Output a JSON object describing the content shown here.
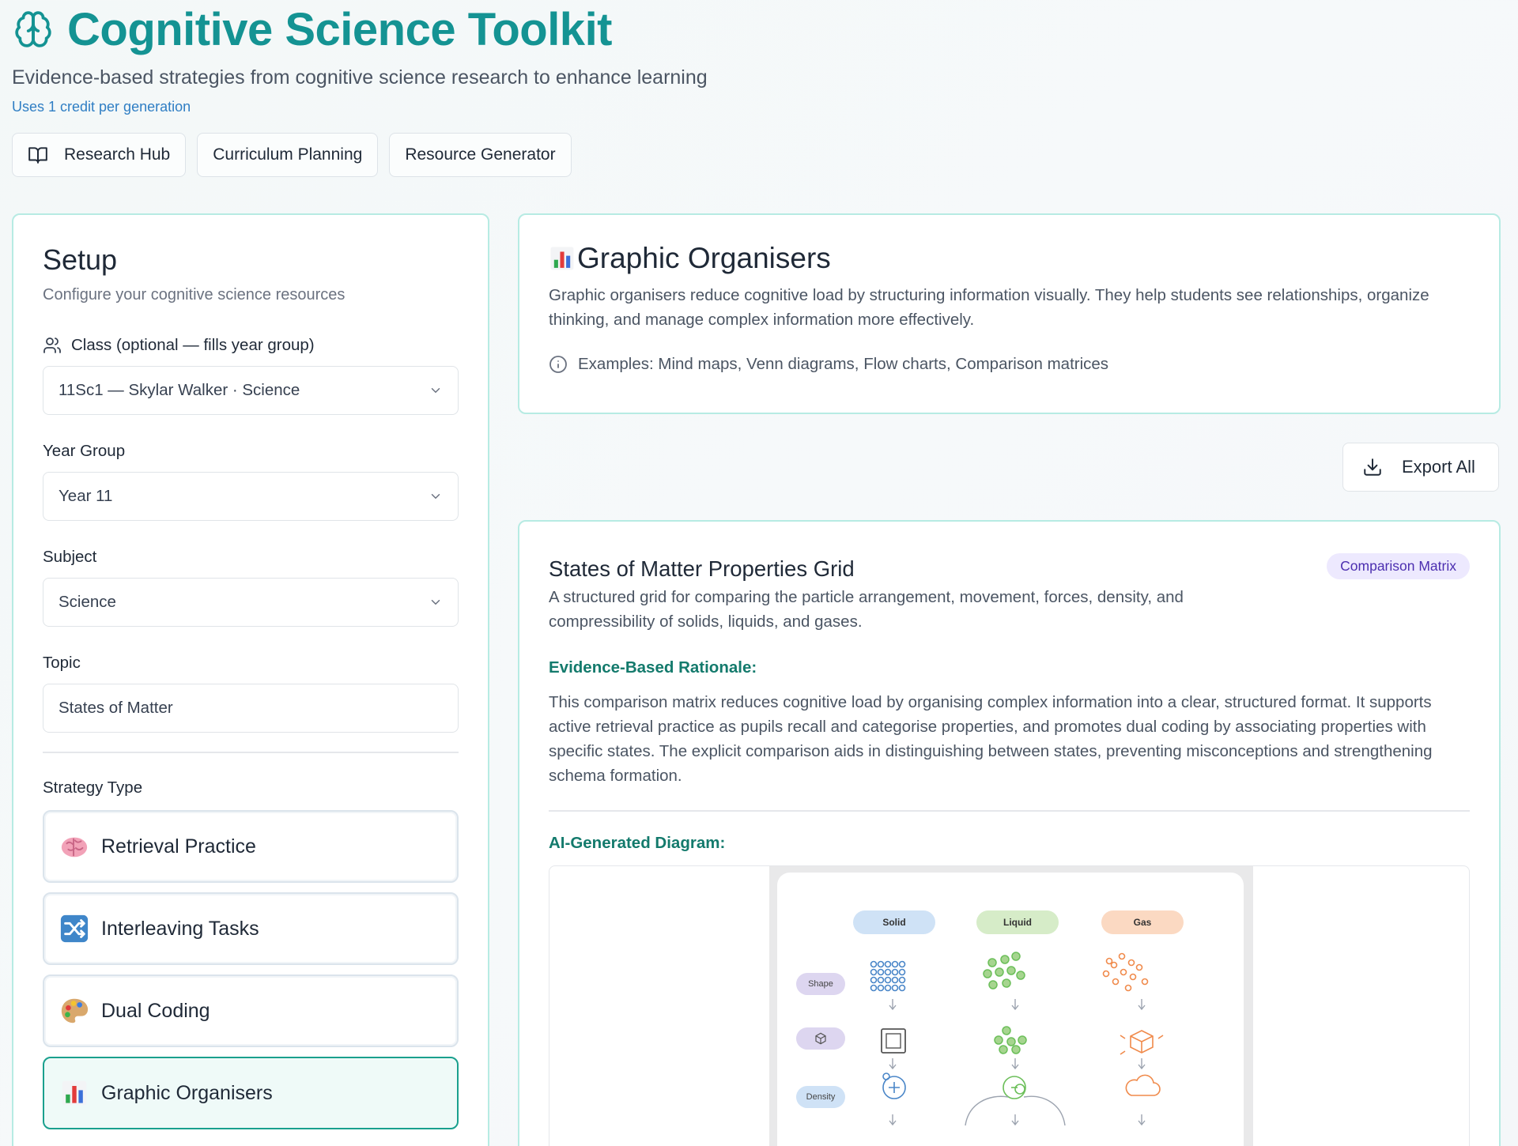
{
  "header": {
    "title": "Cognitive Science Toolkit",
    "subtitle": "Evidence-based strategies from cognitive science research to enhance learning",
    "credit": "Uses 1 credit per generation"
  },
  "nav": {
    "research_hub": "Research Hub",
    "curriculum_planning": "Curriculum Planning",
    "resource_generator": "Resource Generator"
  },
  "setup": {
    "title": "Setup",
    "description": "Configure your cognitive science resources",
    "class_label": "Class (optional — fills year group)",
    "class_value": "11Sc1 — Skylar Walker · Science",
    "year_label": "Year Group",
    "year_value": "Year 11",
    "subject_label": "Subject",
    "subject_value": "Science",
    "topic_label": "Topic",
    "topic_value": "States of Matter",
    "strategy_label": "Strategy Type",
    "strategies": [
      {
        "label": "Retrieval Practice",
        "icon": "brain-emoji"
      },
      {
        "label": "Interleaving Tasks",
        "icon": "shuffle-emoji"
      },
      {
        "label": "Dual Coding",
        "icon": "palette-emoji"
      },
      {
        "label": "Graphic Organisers",
        "icon": "bar-chart-emoji",
        "selected": true
      }
    ]
  },
  "info": {
    "title": "Graphic Organisers",
    "description": "Graphic organisers reduce cognitive load by structuring information visually. They help students see relationships, organize thinking, and manage complex information more effectively.",
    "examples": "Examples: Mind maps, Venn diagrams, Flow charts, Comparison matrices"
  },
  "export_label": "Export All",
  "result": {
    "title": "States of Matter Properties Grid",
    "badge": "Comparison Matrix",
    "description": "A structured grid for comparing the particle arrangement, movement, forces, density, and compressibility of solids, liquids, and gases.",
    "rationale_heading": "Evidence-Based Rationale:",
    "rationale": "This comparison matrix reduces cognitive load by organising complex information into a clear, structured format. It supports active retrieval practice as pupils recall and categorise properties, and promotes dual coding by associating properties with specific states. The explicit comparison aids in distinguishing between states, preventing misconceptions and strengthening schema formation.",
    "diagram_heading": "AI-Generated Diagram:",
    "diagram": {
      "columns": [
        "Solid",
        "Liquid",
        "Gas"
      ],
      "rows": [
        "Shape",
        "",
        "Density"
      ],
      "colors": {
        "solid": "#4a86c8",
        "liquid": "#6cbf5a",
        "gas": "#f08a4b",
        "accent": "#149393"
      }
    }
  }
}
